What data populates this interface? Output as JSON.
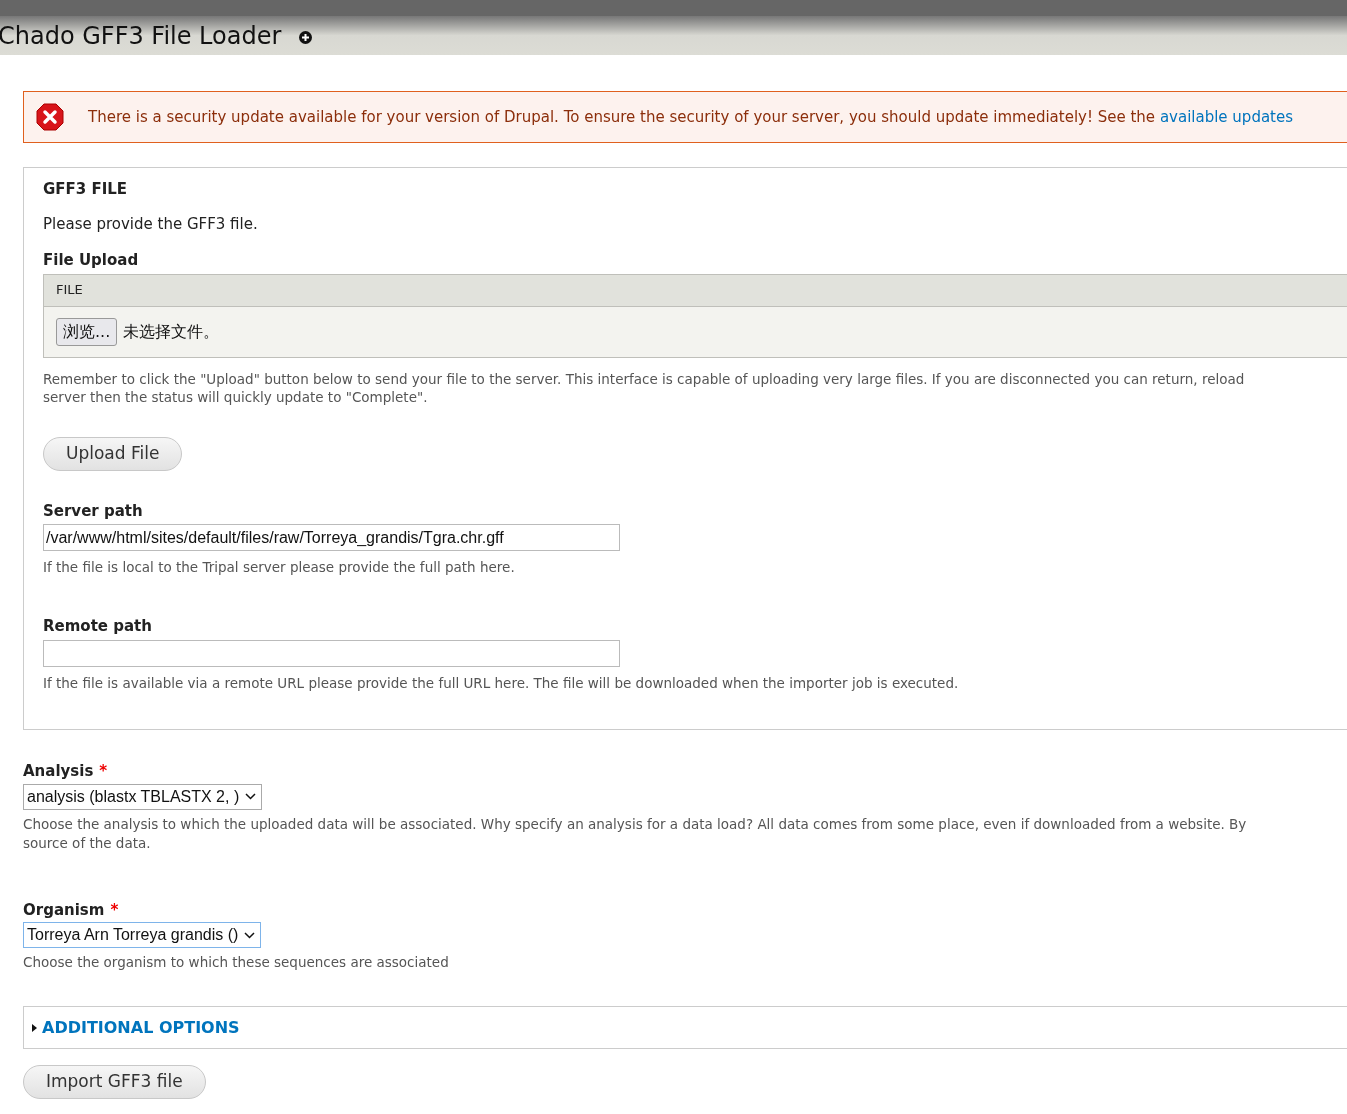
{
  "page_title": "Chado GFF3 File Loader",
  "alert": {
    "text": "There is a security update available for your version of Drupal. To ensure the security of your server, you should update immediately! See the",
    "link": "available updates"
  },
  "fieldset": {
    "legend": "GFF3 FILE",
    "intro": "Please provide the GFF3 file.",
    "upload": {
      "label": "File Upload",
      "table_header": "FILE",
      "browse_button": "浏览...",
      "file_status": "未选择文件。",
      "help_lines": [
        "Remember to click the \"Upload\" button below to send your file to the server. This interface is capable of uploading very large files. If you are disconnected you can return, reload",
        "server then the status will quickly update to \"Complete\"."
      ],
      "button": "Upload File"
    },
    "server_path": {
      "label": "Server path",
      "value": "/var/www/html/sites/default/files/raw/Torreya_grandis/Tgra.chr.gff",
      "help": "If the file is local to the Tripal server please provide the full path here."
    },
    "remote_path": {
      "label": "Remote path",
      "help": "If the file is available via a remote URL please provide the full URL here. The file will be downloaded when the importer job is executed."
    }
  },
  "selects": [
    {
      "label": "Analysis",
      "required_marker": "*",
      "value": "analysis (blastx TBLASTX 2, )",
      "focused": false,
      "help_lines": [
        "Choose the analysis to which the uploaded data will be associated. Why specify an analysis for a data load? All data comes from some place, even if downloaded from a website. By",
        "source of the data."
      ]
    },
    {
      "label": "Organism",
      "required_marker": "*",
      "value": "Torreya Arn Torreya grandis ()",
      "focused": true,
      "help_lines": [
        "Choose the organism to which these sequences are associated"
      ]
    }
  ],
  "additional_options": {
    "label": "ADDITIONAL OPTIONS",
    "expanded": false
  },
  "submit": "Import GFF3 file"
}
